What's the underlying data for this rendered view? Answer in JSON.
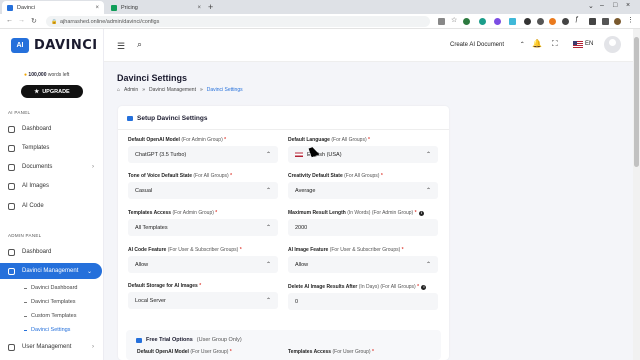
{
  "browser": {
    "tabs": [
      {
        "title": "Davinci",
        "active": true,
        "favicon_color": "#2570db"
      },
      {
        "title": "Pricing",
        "active": false,
        "favicon_color": "#0f9d58"
      }
    ],
    "url": "ajharrashed.online/admin/davinci/configs"
  },
  "sidebar": {
    "logo_badge": "AI",
    "logo_text": "DAVINCI",
    "credits_count": "100,000",
    "credits_suffix": "words left",
    "upgrade_label": "UPGRADE",
    "ai_panel_label": "AI PANEL",
    "ai_items": [
      {
        "label": "Dashboard"
      },
      {
        "label": "Templates"
      },
      {
        "label": "Documents"
      },
      {
        "label": "AI Images"
      },
      {
        "label": "AI Code"
      }
    ],
    "admin_panel_label": "ADMIN PANEL",
    "admin_items": [
      {
        "label": "Dashboard"
      },
      {
        "label": "Davinci Management"
      }
    ],
    "sub_items": [
      {
        "label": "Davinci Dashboard"
      },
      {
        "label": "Davinci Templates"
      },
      {
        "label": "Custom Templates"
      },
      {
        "label": "Davinci Settings"
      }
    ],
    "user_management_label": "User Management"
  },
  "topbar": {
    "create_doc_label": "Create AI Document",
    "language": "EN"
  },
  "page": {
    "title": "Davinci Settings",
    "breadcrumb": [
      "Admin",
      "Davinci Management",
      "Davinci Settings"
    ]
  },
  "card": {
    "title": "Setup Davinci Settings",
    "fields": {
      "openai_model": {
        "label": "Default OpenAI Model",
        "hint": "(For Admin Group)",
        "value": "ChatGPT (3.5 Turbo)"
      },
      "default_language": {
        "label": "Default Language",
        "hint": "(For All Groups)",
        "value": "English (USA)"
      },
      "tone_of_voice": {
        "label": "Tone of Voice Default State",
        "hint": "(For All Groups)",
        "value": "Casual"
      },
      "creativity": {
        "label": "Creativity Default State",
        "hint": "(For All Groups)",
        "value": "Average"
      },
      "templates_access": {
        "label": "Templates Access",
        "hint": "(For Admin Group)",
        "value": "All Templates"
      },
      "max_result_length": {
        "label": "Maximum Result Length",
        "hint": "(In Words) (For Admin Group)",
        "value": "2000"
      },
      "ai_code_feature": {
        "label": "AI Code Feature",
        "hint": "(For User & Subscriber Groups)",
        "value": "Allow"
      },
      "ai_image_feature": {
        "label": "AI Image Feature",
        "hint": "(For User & Subscriber Groups)",
        "value": "Allow"
      },
      "default_storage": {
        "label": "Default Storage for AI Images",
        "hint": "",
        "value": "Local Server"
      },
      "delete_ai_image": {
        "label": "Delete AI Image Results After",
        "hint": "(In Days) (For All Groups)",
        "value": "0"
      }
    },
    "trial": {
      "title": "Free Trial Options",
      "hint": "(User Group Only)",
      "field1_label": "Default OpenAI Model",
      "field1_hint": "(For User Group)",
      "field2_label": "Templates Access",
      "field2_hint": "(For User Group)"
    }
  },
  "colors": {
    "accent": "#2570db",
    "required": "#e0463d"
  }
}
